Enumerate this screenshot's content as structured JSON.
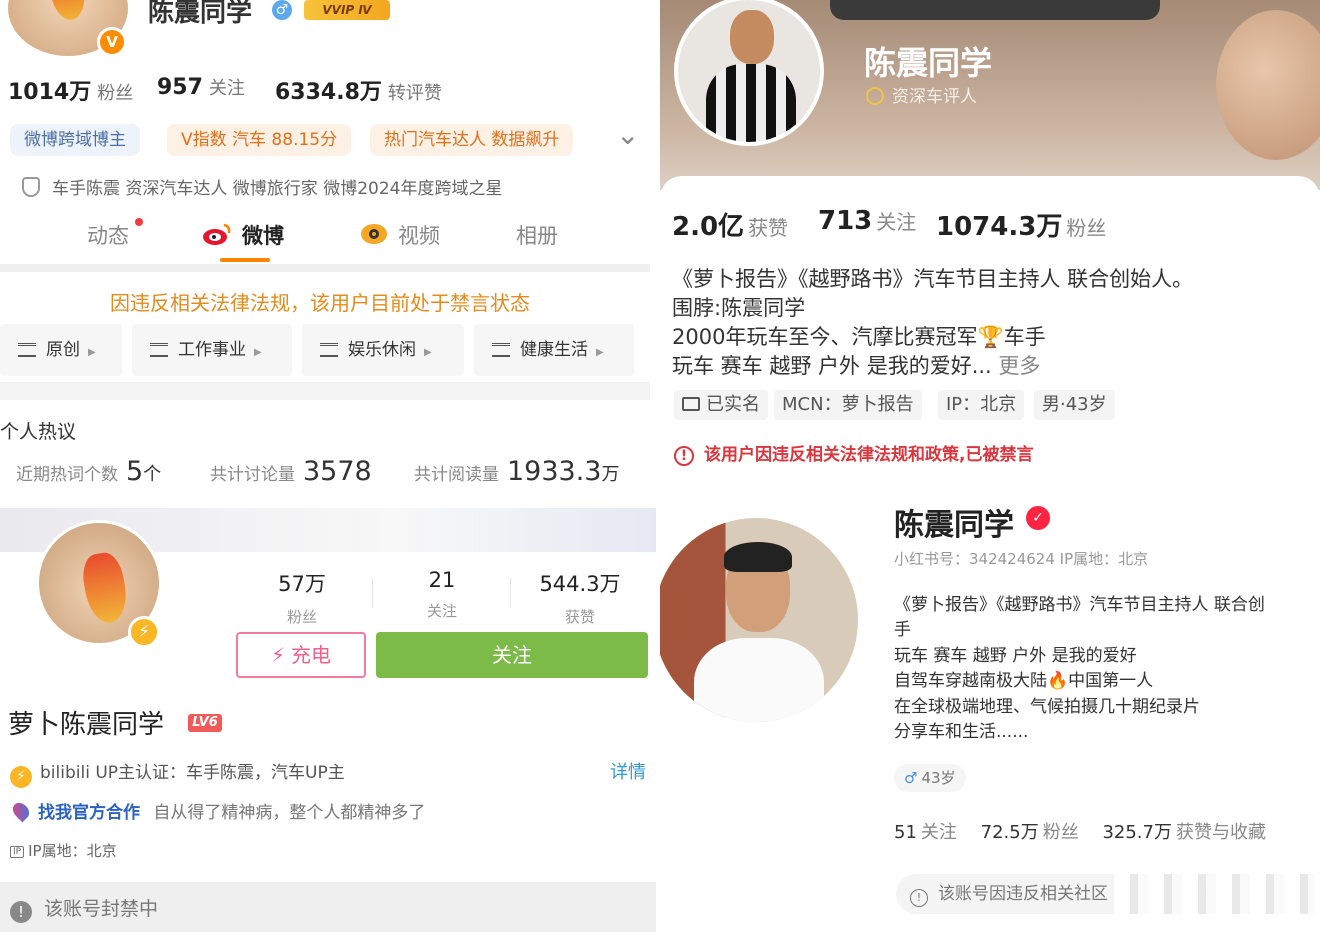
{
  "weibo": {
    "name": "陈震同学",
    "badge_v": "V",
    "male_glyph": "♂",
    "vip_label": "VVIP Ⅳ",
    "stats": [
      {
        "num": "1014万",
        "label": "粉丝"
      },
      {
        "num": "957",
        "label": "关注"
      },
      {
        "num": "6334.8万",
        "label": "转评赞"
      }
    ],
    "tags": [
      "微博跨域博主",
      "V指数 汽车 88.15分",
      "热门汽车达人 数据飙升"
    ],
    "expand_glyph": "⌄",
    "cert": "车手陈震 资深汽车达人 微博旅行家 微博2024年度跨域之星",
    "tabs": [
      "动态",
      "微博",
      "视频",
      "相册"
    ],
    "ban_notice": "因违反相关法律法规，该用户目前处于禁言状态",
    "categories": [
      "原创",
      "工作事业",
      "娱乐休闲",
      "健康生活"
    ],
    "hot": {
      "title": "个人热议",
      "items": [
        {
          "label": "近期热词个数",
          "value": "5",
          "unit": "个"
        },
        {
          "label": "共计讨论量",
          "value": "3578",
          "unit": ""
        },
        {
          "label": "共计阅读量",
          "value": "1933.3",
          "unit": "万"
        }
      ]
    }
  },
  "xhs_top": {
    "name": "陈震同学",
    "subtitle": "资深车评人",
    "stats": [
      {
        "num": "2.0亿",
        "label": "获赞"
      },
      {
        "num": "713",
        "label": "关注"
      },
      {
        "num": "1074.3万",
        "label": "粉丝"
      }
    ],
    "bio": [
      "《萝卜报告》《越野路书》汽车节目主持人 联合创始人。",
      "围脖:陈震同学",
      "2000年玩车至今、汽摩比赛冠军🏆车手",
      "玩车 赛车 越野 户外 是我的爱好..."
    ],
    "more": "更多",
    "tags": [
      "已实名",
      "MCN：萝卜报告",
      "IP：北京",
      "男·43岁"
    ],
    "ban_notice": "该用户因违反相关法律法规和政策,已被禁言"
  },
  "bilibili": {
    "stats": [
      {
        "num": "57万",
        "label": "粉丝"
      },
      {
        "num": "21",
        "label": "关注"
      },
      {
        "num": "544.3万",
        "label": "获赞"
      }
    ],
    "charge_label": "充电",
    "follow_label": "关注",
    "name": "萝卜陈震同学",
    "level": "LV6",
    "cert": "bilibili UP主认证：车手陈震，汽车UP主",
    "detail": "详情",
    "coop_link": "找我官方合作",
    "signature": "自从得了精神病，整个人都精神多了",
    "ip_icon": "IP",
    "ip": "IP属地：北京",
    "banned": "该账号封禁中"
  },
  "xhs_bottom": {
    "name": "陈震同学",
    "id_line": "小红书号：342424624   IP属地：北京",
    "bio": [
      "《萝卜报告》《越野路书》汽车节目主持人 联合创",
      "手",
      "玩车 赛车 越野 户外 是我的爱好",
      "自驾车穿越南极大陆🔥中国第一人",
      "在全球极端地理、气候拍摄几十期纪录片",
      "分享车和生活......"
    ],
    "age": "43岁",
    "stats": [
      {
        "num": "51",
        "label": "关注"
      },
      {
        "num": "72.5万",
        "label": "粉丝"
      },
      {
        "num": "325.7万",
        "label": "获赞与收藏"
      }
    ],
    "ban_notice": "该账号因违反相关社区"
  },
  "colors": {
    "weibo_orange": "#ff8200",
    "bili_pink": "#f0608a",
    "bili_green": "#7dbb48",
    "xhs_red": "#ff2442",
    "ban_red": "#d9363e"
  }
}
